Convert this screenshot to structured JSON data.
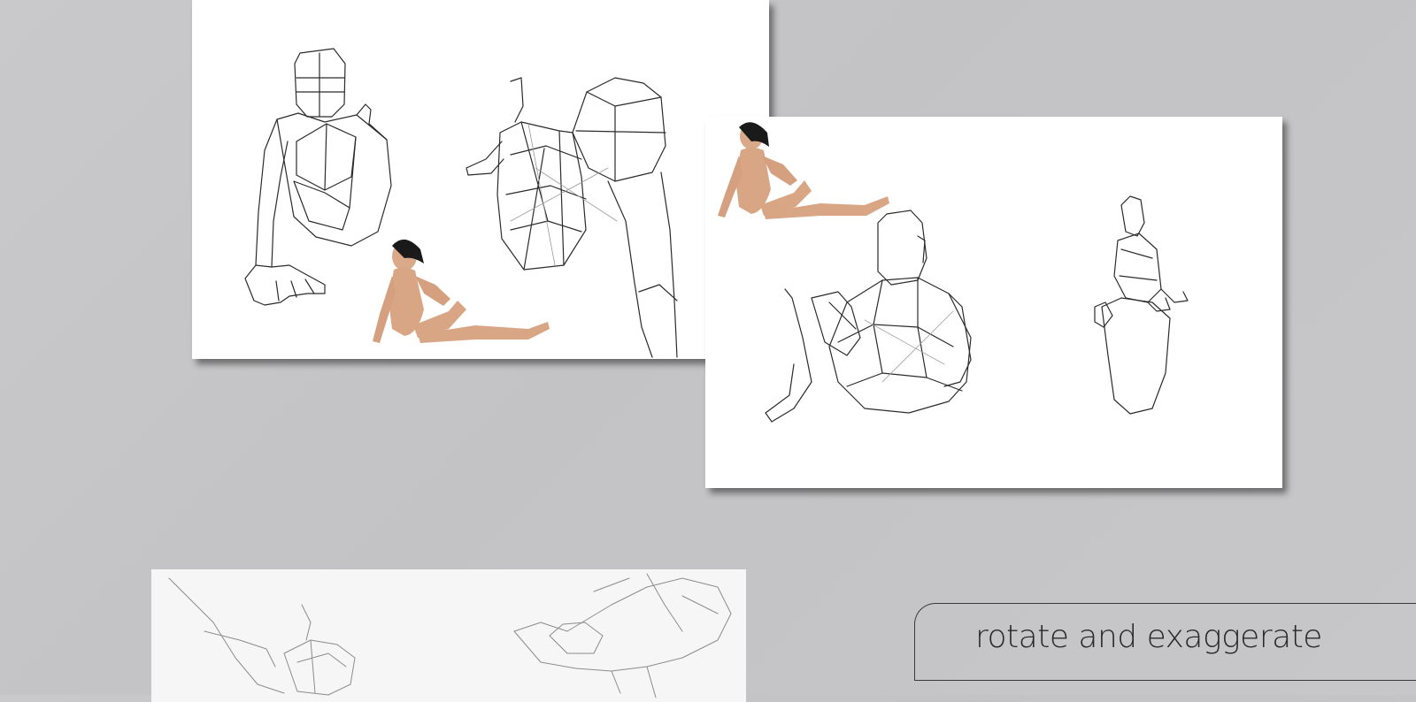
{
  "caption": {
    "text": "rotate and exaggerate"
  },
  "colors": {
    "background": "#c6c6c8",
    "card": "#ffffff",
    "sketch_line": "#2b2b2b",
    "faint_line": "#9a9a9a",
    "skin": "#d9a98a",
    "hair": "#1a1a1a"
  },
  "panels": [
    {
      "name": "sketch-panel-1",
      "content": "figure construction sketches with reference photo"
    },
    {
      "name": "sketch-panel-2",
      "content": "rotated figure sketches with reference photo"
    },
    {
      "name": "sketch-panel-3",
      "content": "faint pencil sketches"
    }
  ]
}
